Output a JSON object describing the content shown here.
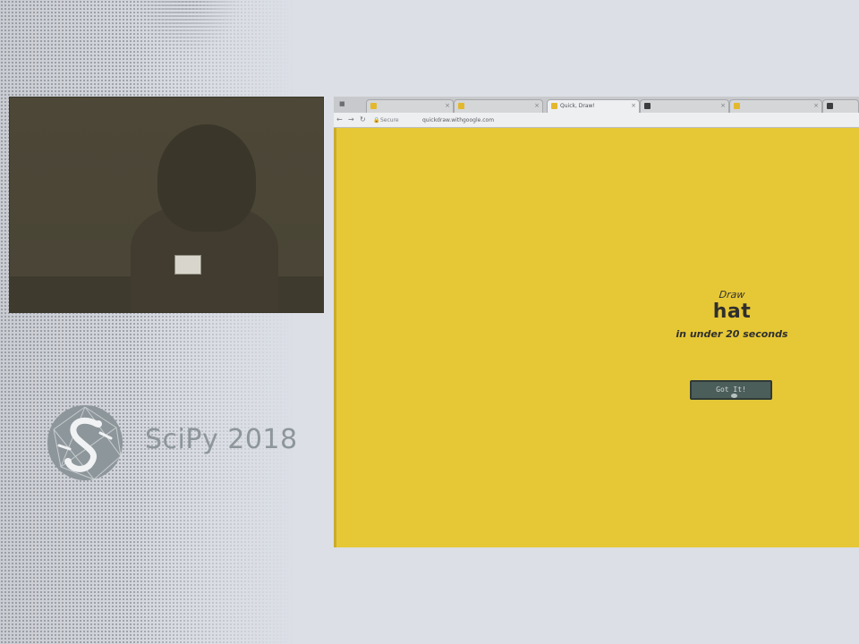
{
  "slide": {
    "logo_text": "SciPy 2018",
    "accent_gray": "#8d969a",
    "background": "#dcdfe6"
  },
  "webcam": {
    "badge_text": ""
  },
  "browser": {
    "tabs": [
      {
        "label": "",
        "active": false
      },
      {
        "label": "",
        "active": false
      },
      {
        "label": "",
        "active": false
      },
      {
        "label": "Quick, Draw!",
        "active": true
      },
      {
        "label": "",
        "active": false
      },
      {
        "label": "",
        "active": false
      },
      {
        "label": "",
        "active": false
      }
    ],
    "address": {
      "secure_label": "Secure",
      "url": "quickdraw.withgoogle.com"
    },
    "page_background": "#e6c836"
  },
  "prompt": {
    "draw_label": "Draw",
    "word": "hat",
    "timer_text": "in under 20 seconds",
    "button_label": "Got It!"
  }
}
